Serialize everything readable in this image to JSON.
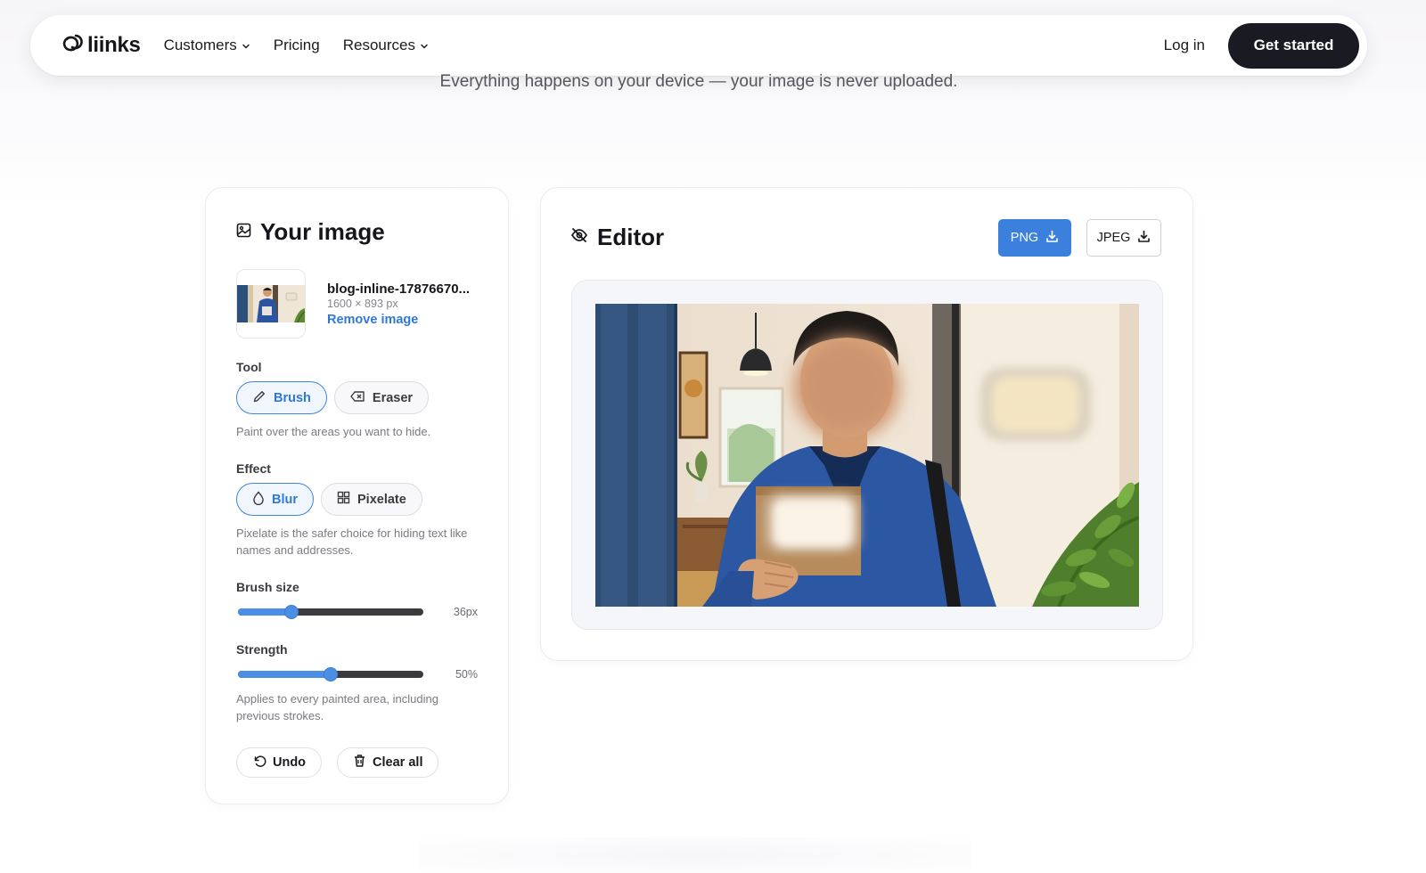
{
  "brand": {
    "name": "liinks",
    "icon": "link-chain-icon"
  },
  "nav": {
    "links": [
      {
        "label": "Customers",
        "has_menu": true
      },
      {
        "label": "Pricing",
        "has_menu": false
      },
      {
        "label": "Resources",
        "has_menu": true
      }
    ],
    "login": "Log in",
    "cta": "Get started"
  },
  "subtitle": "Everything happens on your device — your image is never uploaded.",
  "image_panel": {
    "title": "Your image",
    "file_name": "blog-inline-17876670...",
    "dimensions": "1600 × 893 px",
    "remove": "Remove image",
    "tool_label": "Tool",
    "tools": [
      {
        "label": "Brush",
        "icon": "pencil-icon",
        "active": true
      },
      {
        "label": "Eraser",
        "icon": "eraser-icon",
        "active": false
      }
    ],
    "tool_hint": "Paint over the areas you want to hide.",
    "effect_label": "Effect",
    "effects": [
      {
        "label": "Blur",
        "icon": "droplet-icon",
        "active": true
      },
      {
        "label": "Pixelate",
        "icon": "grid-icon",
        "active": false
      }
    ],
    "effect_hint": "Pixelate is the safer choice for hiding text like names and addresses.",
    "brush_size_label": "Brush size",
    "brush_size_value": "36px",
    "brush_size_fraction": 0.27,
    "strength_label": "Strength",
    "strength_value": "50%",
    "strength_fraction": 0.5,
    "strength_hint": "Applies to every painted area, including previous strokes.",
    "undo": "Undo",
    "clear": "Clear all"
  },
  "editor": {
    "title": "Editor",
    "png": "PNG",
    "jpeg": "JPEG"
  },
  "colors": {
    "accent": "#3a80dc",
    "dark": "#1a1b22"
  }
}
